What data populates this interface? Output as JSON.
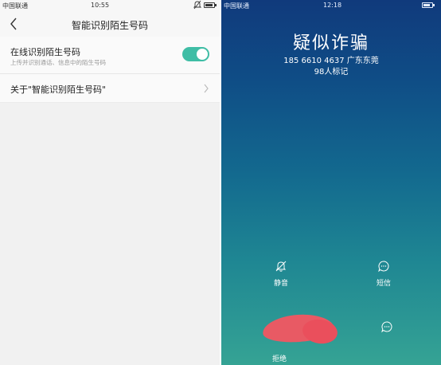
{
  "left_screen": {
    "status_bar": {
      "carrier": "中国联通",
      "time": "10:55"
    },
    "nav": {
      "title": "智能识别陌生号码"
    },
    "settings": {
      "online_identify": {
        "title": "在线识别陌生号码",
        "subtitle": "上传并识别通话、信息中的陌生号码",
        "enabled": true
      },
      "about": {
        "title": "关于\"智能识别陌生号码\""
      }
    },
    "colors": {
      "toggle_on": "#3fbda5",
      "background": "#f1f1f1"
    }
  },
  "right_screen": {
    "status_bar": {
      "carrier": "中国联通",
      "time": "12:18"
    },
    "caller": {
      "label": "疑似诈骗",
      "number_location": "185 6610 4637 广东东莞",
      "marked_count": "98人标记"
    },
    "actions": {
      "mute": {
        "label": "静音",
        "icon": "bell-off-icon"
      },
      "sms": {
        "label": "短信",
        "icon": "message-bubble-icon"
      },
      "decline": {
        "label": "拒绝",
        "icon": "decline-handset-icon",
        "color": "#e85a64"
      },
      "reply_icon": "message-bubble-icon"
    },
    "colors": {
      "gradient_top": "#103a7c",
      "gradient_bottom": "#35a394"
    }
  }
}
